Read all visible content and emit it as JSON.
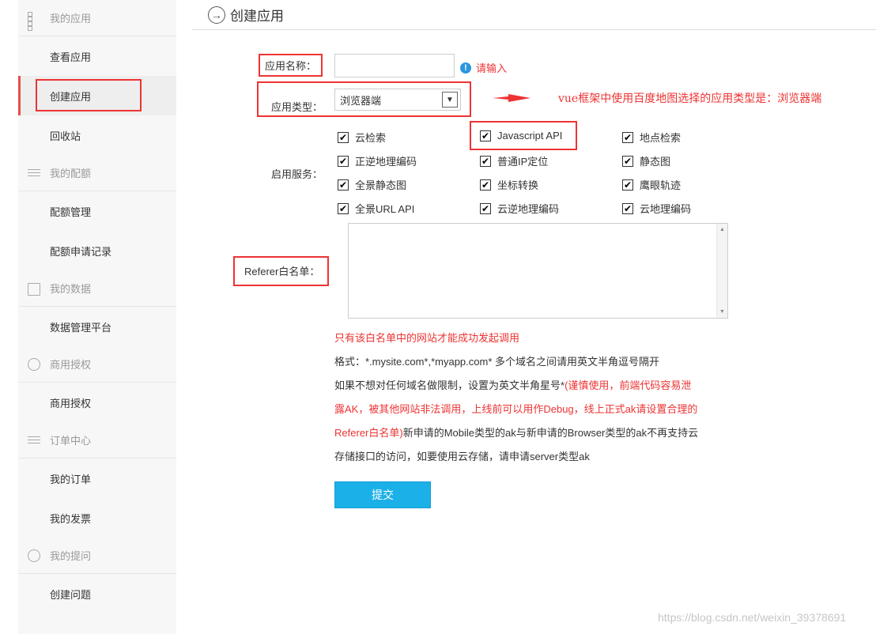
{
  "sidebar": {
    "groups": [
      {
        "label": "我的应用",
        "items": [
          "查看应用",
          "创建应用",
          "回收站"
        ]
      },
      {
        "label": "我的配额",
        "items": [
          "配额管理",
          "配额申请记录"
        ]
      },
      {
        "label": "我的数据",
        "items": [
          "数据管理平台"
        ]
      },
      {
        "label": "商用授权",
        "items": [
          "商用授权"
        ]
      },
      {
        "label": "订单中心",
        "items": [
          "我的订单",
          "我的发票"
        ]
      },
      {
        "label": "我的提问",
        "items": [
          "创建问题"
        ]
      }
    ]
  },
  "header": {
    "title": "创建应用"
  },
  "form": {
    "app_name_label": "应用名称：",
    "app_name_value": "",
    "app_name_warning": "请输入",
    "app_type_label": "应用类型：",
    "app_type_selected": "浏览器端",
    "services_label": "启用服务：",
    "services": [
      {
        "label": "云检索",
        "checked": true
      },
      {
        "label": "Javascript API",
        "checked": true
      },
      {
        "label": "地点检索",
        "checked": true
      },
      {
        "label": "正逆地理编码",
        "checked": true
      },
      {
        "label": "普通IP定位",
        "checked": true
      },
      {
        "label": "静态图",
        "checked": true
      },
      {
        "label": "全景静态图",
        "checked": true
      },
      {
        "label": "坐标转换",
        "checked": true
      },
      {
        "label": "鹰眼轨迹",
        "checked": true
      },
      {
        "label": "全景URL API",
        "checked": true
      },
      {
        "label": "云逆地理编码",
        "checked": true
      },
      {
        "label": "云地理编码",
        "checked": true
      }
    ],
    "referer_label": "Referer白名单：",
    "referer_value": "",
    "hints": {
      "line1": "只有该白名单中的网站才能成功发起调用",
      "line2": "格式：*.mysite.com*,*myapp.com* 多个域名之间请用英文半角逗号隔开",
      "line3_a": "如果不想对任何域名做限制，设置为英文半角星号*",
      "line3_b": "(谨慎使用，前端代码容易泄",
      "line4": "露AK，被其他网站非法调用，上线前可以用作Debug，线上正式ak请设置合理的",
      "line5_a": "Referer白名单)",
      "line5_b": "新申请的Mobile类型的ak与新申请的Browser类型的ak不再支持云",
      "line6": "存储接口的访问，如要使用云存储，请申请server类型ak"
    },
    "submit_label": "提交"
  },
  "annotation": {
    "text": "vue框架中使用百度地图选择的应用类型是：浏览器端"
  },
  "watermark": "https://blog.csdn.net/weixin_39378691",
  "colors": {
    "accent_red": "#e33333",
    "submit_blue": "#1cb0e8",
    "info_blue": "#2a96e0"
  }
}
